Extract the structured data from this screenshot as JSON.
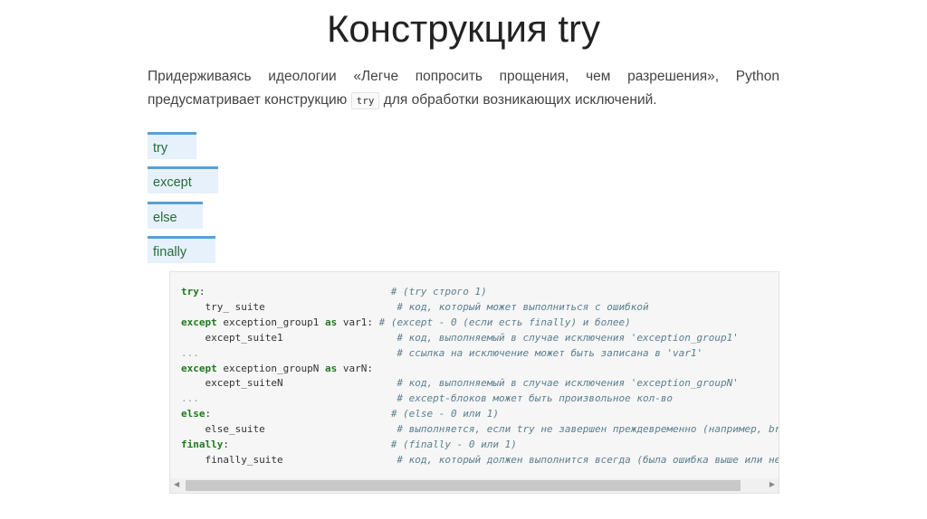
{
  "title": "Конструкция try",
  "paragraph": {
    "before": "Придерживаясь идеологии «Легче попросить прощения, чем разрешения», Python предусматривает конструкцию",
    "code": "try",
    "after": "для обработки возникающих исключений."
  },
  "keywords": [
    "try",
    "except",
    "else",
    "finally"
  ],
  "code_lines": [
    [
      {
        "t": "try",
        "k": "kw"
      },
      {
        "t": ":                               ",
        "k": "p"
      },
      {
        "t": "# (try строго 1)",
        "k": "cm"
      }
    ],
    [
      {
        "t": "    try_ suite                      ",
        "k": "p"
      },
      {
        "t": "# код, который может выполниться с ошибкой",
        "k": "cm"
      }
    ],
    [
      {
        "t": "except",
        "k": "kw"
      },
      {
        "t": " exception_group1 ",
        "k": "p"
      },
      {
        "t": "as",
        "k": "kw"
      },
      {
        "t": " var1: ",
        "k": "p"
      },
      {
        "t": "# (except - 0 (если есть finally) и более)",
        "k": "cm"
      }
    ],
    [
      {
        "t": "    except_suite1                   ",
        "k": "p"
      },
      {
        "t": "# код, выполняемый в случае исключения 'exception_group1'",
        "k": "cm"
      }
    ],
    [
      {
        "t": "...                                 ",
        "k": "dots"
      },
      {
        "t": "# ссылка на исключение может быть записана в 'var1'",
        "k": "cm"
      }
    ],
    [
      {
        "t": "except",
        "k": "kw"
      },
      {
        "t": " exception_groupN ",
        "k": "p"
      },
      {
        "t": "as",
        "k": "kw"
      },
      {
        "t": " varN:",
        "k": "p"
      }
    ],
    [
      {
        "t": "    except_suiteN                   ",
        "k": "p"
      },
      {
        "t": "# код, выполняемый в случае исключения 'exception_groupN'",
        "k": "cm"
      }
    ],
    [
      {
        "t": "...                                 ",
        "k": "dots"
      },
      {
        "t": "# except-блоков может быть произвольное кол-во",
        "k": "cm"
      }
    ],
    [
      {
        "t": "else",
        "k": "kw"
      },
      {
        "t": ":                              ",
        "k": "p"
      },
      {
        "t": "# (else - 0 или 1)",
        "k": "cm"
      }
    ],
    [
      {
        "t": "    else_suite                      ",
        "k": "p"
      },
      {
        "t": "# выполняется, если try не завершен преждевременно (например, break)",
        "k": "cm"
      }
    ],
    [
      {
        "t": "finally",
        "k": "kw"
      },
      {
        "t": ":                           ",
        "k": "p"
      },
      {
        "t": "# (finally - 0 или 1)",
        "k": "cm"
      }
    ],
    [
      {
        "t": "    finally_suite                   ",
        "k": "p"
      },
      {
        "t": "# код, который должен выполнится всегда (была ошибка выше или нет)",
        "k": "cm"
      }
    ]
  ],
  "colors": {
    "accent": "#5a9fd4",
    "keyword": "#1f7a1f",
    "tab_bg": "#e6f1fb"
  }
}
